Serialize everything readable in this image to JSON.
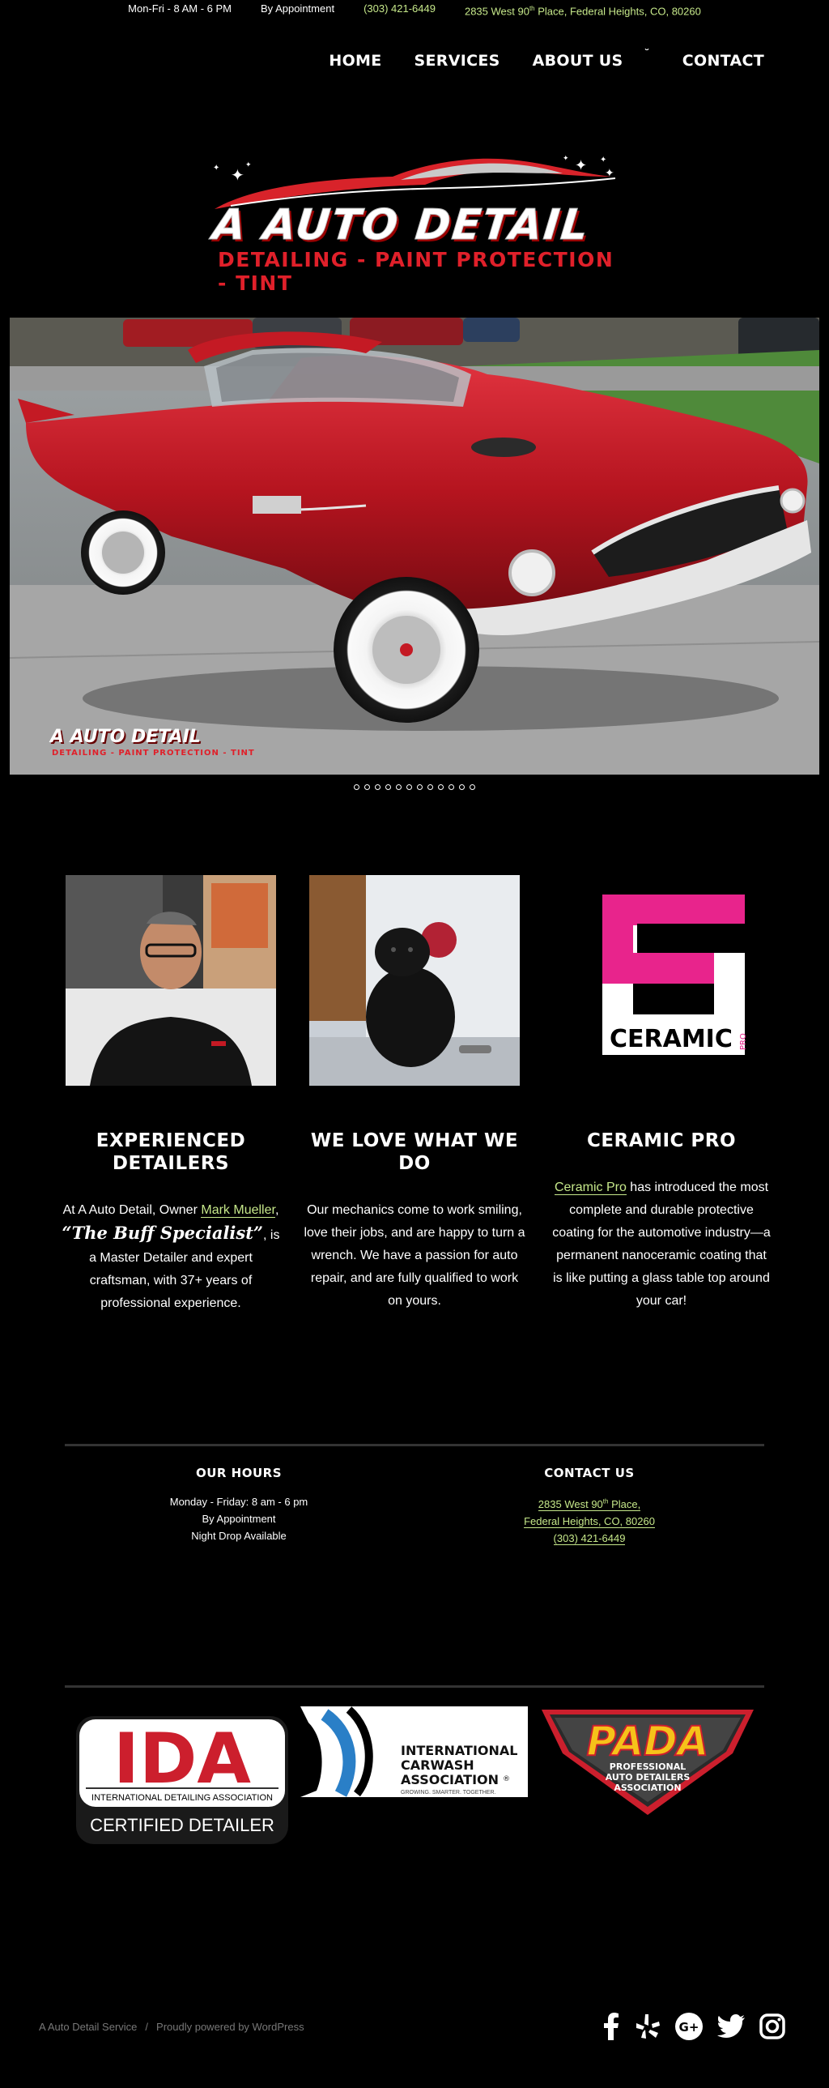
{
  "topbar": {
    "hours": "Mon-Fri - 8 AM - 6 PM",
    "appointment": "By Appointment",
    "phone": "(303) 421-6449",
    "address_num": "2835 West 90",
    "address_sup": "th",
    "address_rest": " Place, Federal Heights, CO, 80260"
  },
  "nav": {
    "items": [
      "HOME",
      "SERVICES",
      "ABOUT US",
      "CONTACT"
    ],
    "dropdown_icon": "chevron-down-icon"
  },
  "logo": {
    "title": "A AUTO DETAIL",
    "tagline": "DETAILING - PAINT PROTECTION - TINT"
  },
  "hero": {
    "watermark_title": "A AUTO DETAIL",
    "watermark_tagline": "DETAILING - PAINT PROTECTION - TINT",
    "dots_count": 12
  },
  "features": [
    {
      "title": "EXPERIENCED DETAILERS",
      "text_pre": "At A Auto Detail, Owner ",
      "link": "Mark Mueller",
      "comma": ", ",
      "quote": "“The Buff Specialist”",
      "text_post": ", is a Master Detailer and expert craftsman, with 37+ years of professional experience."
    },
    {
      "title": "WE LOVE WHAT WE DO",
      "text": "Our mechanics come to work smiling, love their jobs, and are happy to turn a wrench. We have a passion for auto repair, and are fully qualified to work on yours."
    },
    {
      "title": "CERAMIC PRO",
      "link": "Ceramic Pro",
      "text_post": " has introduced the most complete and durable protective coating for the automotive industry—a permanent nanoceramic coating that is like putting a glass table top around your car!",
      "logo_text": "CERAMIC",
      "logo_sub": "PRO"
    }
  ],
  "hours_widget": {
    "title": "OUR HOURS",
    "lines": [
      "Monday - Friday: 8 am - 6 pm",
      "By Appointment",
      "Night Drop Available"
    ]
  },
  "contact_widget": {
    "title": "CONTACT US",
    "address_num": "2835 West 90",
    "address_sup": "th",
    "address_rest": " Place,",
    "city": "Federal Heights, CO, 80260",
    "phone": "(303) 421-6449"
  },
  "badges": {
    "ida_title": "IDA",
    "ida_name": "INTERNATIONAL DETAILING ASSOCIATION",
    "ida_cert": "CERTIFIED DETAILER",
    "ica_line1": "INTERNATIONAL",
    "ica_line2": "CARWASH",
    "ica_line3": "ASSOCIATION",
    "ica_reg": "®",
    "ica_tag": "GROWING. SMARTER. TOGETHER.",
    "pada_title": "PADA",
    "pada_line1": "PROFESSIONAL",
    "pada_line2": "AUTO DETAILERS",
    "pada_line3": "ASSOCIATION"
  },
  "footer": {
    "site_name": "A Auto Detail Service",
    "separator": "/",
    "powered": "Proudly powered by WordPress",
    "social": [
      "facebook-icon",
      "yelp-icon",
      "google-plus-icon",
      "twitter-icon",
      "instagram-icon"
    ]
  },
  "colors": {
    "background": "#000000",
    "accent_link": "#c6e88a",
    "brand_red": "#e0202a",
    "ceramic_pink": "#e8248c"
  }
}
